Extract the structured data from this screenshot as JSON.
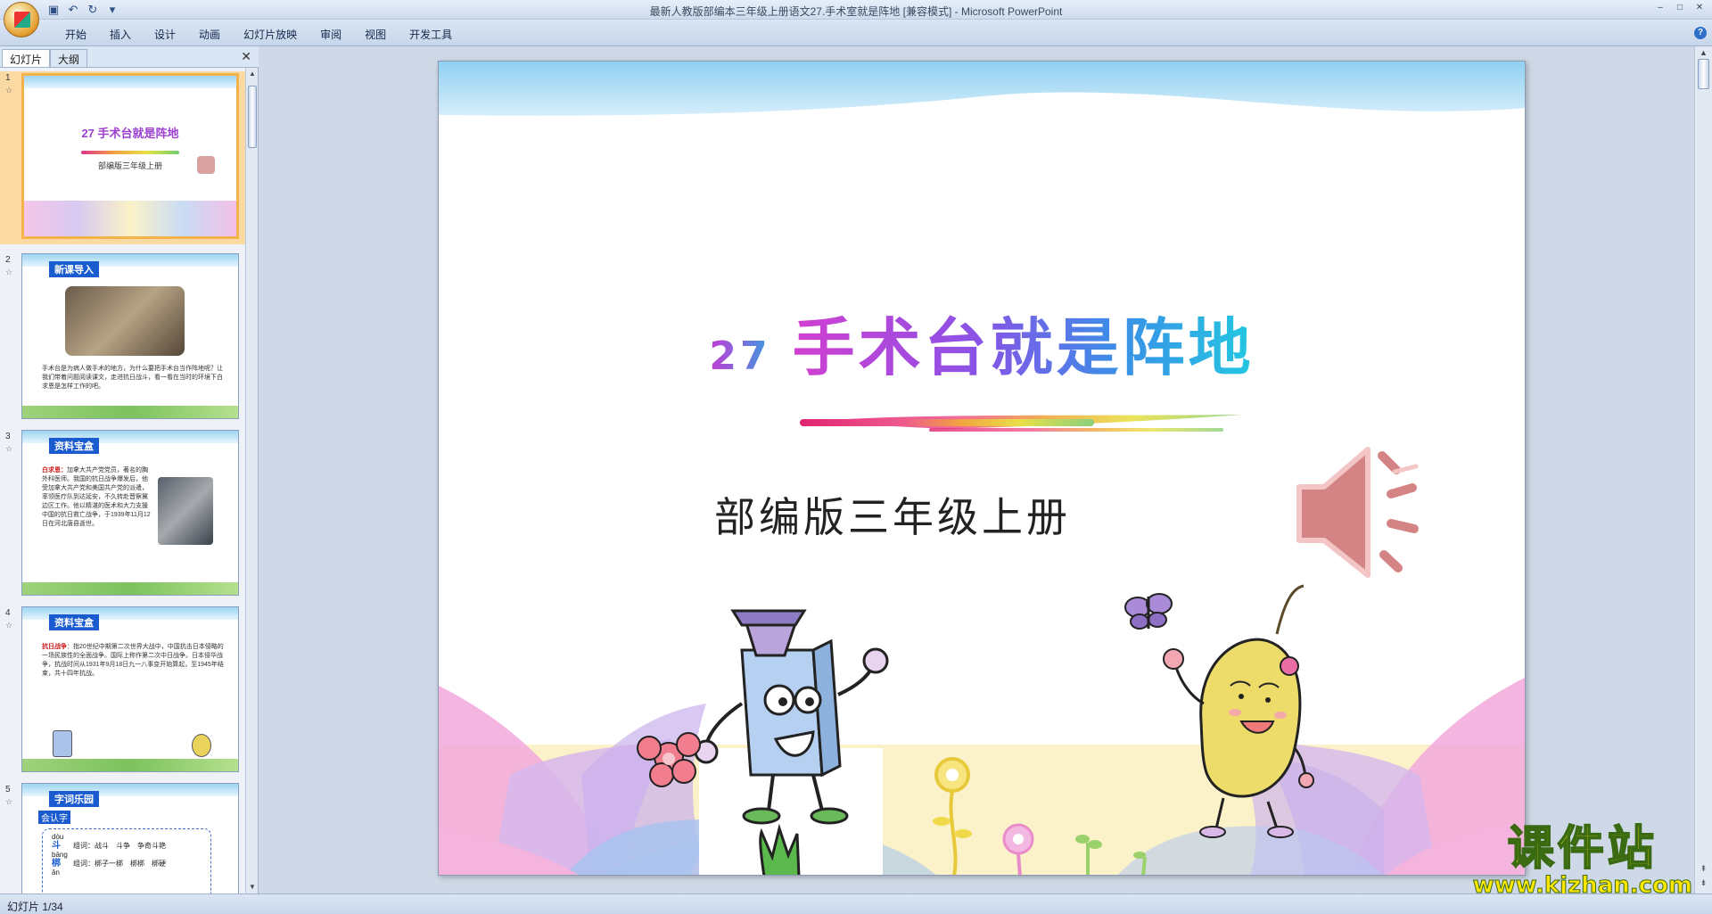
{
  "window": {
    "title": "最新人教版部编本三年级上册语文27.手术室就是阵地 [兼容模式] - Microsoft PowerPoint",
    "controls": [
      "–",
      "□",
      "✕"
    ]
  },
  "quick_access": [
    "save-icon",
    "undo-icon",
    "redo-icon",
    "customize-icon"
  ],
  "ribbon": {
    "tabs": [
      "开始",
      "插入",
      "设计",
      "动画",
      "幻灯片放映",
      "审阅",
      "视图",
      "开发工具"
    ]
  },
  "panel": {
    "tabs": [
      "幻灯片",
      "大纲"
    ],
    "close": "✕"
  },
  "thumbnails": [
    {
      "number": "1",
      "title": "27 手术台就是阵地",
      "subtitle": "部编版三年级上册"
    },
    {
      "number": "2",
      "header": "新课导入",
      "body": "手术台是为病人做手术的地方，为什么要把手术台当作阵地呢？让我们带着问题阅读课文，走进抗日战斗，看一看在当时的环境下白求恩是怎样工作的吧。"
    },
    {
      "number": "3",
      "header": "资料宝盒",
      "highlight": "白求恩：",
      "body": "加拿大共产党党员，著名的胸外科医师。我国的抗日战争爆发后，他受加拿大共产党和美国共产党的派遣，率领医疗队到达延安，不久转赴晋察冀边区工作。他以精湛的医术和大力支援中国的抗日救亡战争，于1939年11月12日在河北唐县逝世。"
    },
    {
      "number": "4",
      "header": "资料宝盒",
      "highlight": "抗日战争",
      "body": "：指20世纪中期第二次世界大战中，中国抗击日本侵略的一场民族性的全面战争。国际上称作第二次中日战争。日本侵华战争，抗战时间从1931年9月18日九一八事变开始算起，至1945年结束，共十四年抗战。"
    },
    {
      "number": "5",
      "header": "字词乐园",
      "tag": "会认字",
      "lines": [
        {
          "pinyin": "dòu",
          "char": "斗",
          "words": "组词：战斗　斗争　争奇斗艳"
        },
        {
          "pinyin": "bāng",
          "char": "梆",
          "words": "组词：梆子一梆　梆梆　梆硬"
        },
        {
          "pinyin": "ǎn",
          "char": "",
          "words": ""
        }
      ]
    }
  ],
  "slide": {
    "number": "27",
    "title": "手术台就是阵地",
    "subtitle": "部编版三年级上册"
  },
  "status": {
    "slide_indicator": "幻灯片 1/34"
  },
  "watermark": {
    "brand": "课件站",
    "url": "www.kjzhan.com"
  },
  "colors": {
    "title_gradient_start": "#d23fd0",
    "title_gradient_end": "#23c8e0",
    "selected_thumb": "#f3b24a",
    "header_badge": "#1a5bd0"
  }
}
